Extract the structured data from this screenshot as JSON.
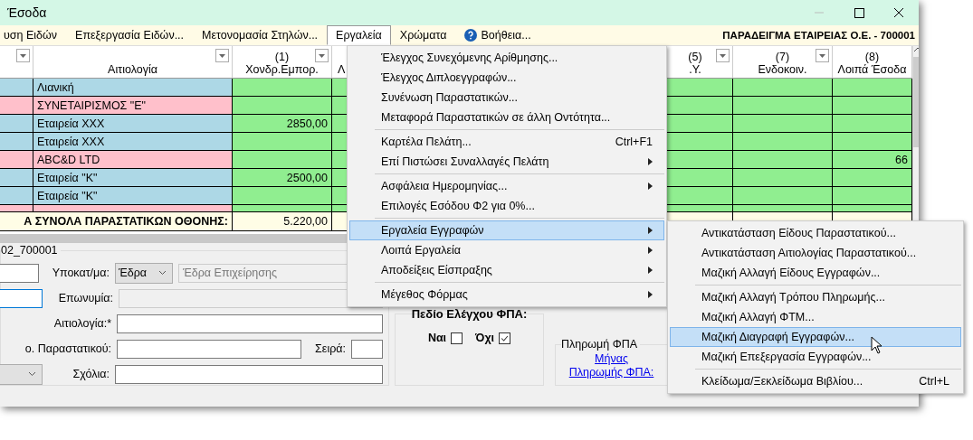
{
  "window": {
    "title": "Έσοδα"
  },
  "menu_bar": {
    "items": [
      {
        "label": "υση Ειδών",
        "selected": false,
        "kind": "text"
      },
      {
        "label": "Επεξεργασία Ειδών...",
        "selected": false,
        "kind": "text"
      },
      {
        "label": "Μετονομασία Στηλών...",
        "selected": false,
        "kind": "text"
      },
      {
        "label": "Εργαλεία",
        "selected": true,
        "kind": "text"
      },
      {
        "label": "Χρώματα",
        "selected": false,
        "kind": "text"
      },
      {
        "label": "Βοήθεια...",
        "selected": false,
        "kind": "help"
      }
    ],
    "company": "ΠΑΡΑΔΕΙΓΜΑ ΕΤΑΙΡΕΙΑΣ Ο.Ε. - 700001"
  },
  "table": {
    "columns": [
      {
        "label": "Αιτιολογία"
      },
      {
        "number": "(1)",
        "label": "Χονδρ.Εμπορ."
      },
      {
        "label": "Λ"
      },
      {
        "number": "(5)",
        "label": ".Υ."
      },
      {
        "number": "(7)",
        "label": "Ενδοκοιν."
      },
      {
        "number": "(8)",
        "label": "Λοιπά Έσοδα"
      }
    ],
    "rows": [
      {
        "label": "Λιανική",
        "color": "#add8e6"
      },
      {
        "label": "ΣΥΝΕΤΑΙΡΙΣΜΟΣ \"Ε\"",
        "color": "#ffc0cb"
      },
      {
        "label": "Εταιρεία XXX",
        "color": "#add8e6",
        "values": {
          "column_1": "2850,00"
        }
      },
      {
        "label": "Εταιρεία XXX",
        "color": "#add8e6"
      },
      {
        "label": "ABC&D LTD",
        "color": "#ffc0cb",
        "values": {
          "column_5": "66"
        }
      },
      {
        "label": "Εταιρεία \"Κ\"",
        "color": "#add8e6",
        "values": {
          "column_1": "2500,00"
        }
      },
      {
        "label": "Εταιρεία \"Κ\"",
        "color": "#add8e6"
      },
      {
        "color": "#ffc0cb"
      }
    ],
    "totals": {
      "label": "Α ΣΥΝΟΛΑ ΠΑΡΑΣΤΑΤΙΚΩΝ ΟΘΟΝΗΣ:",
      "values": {
        "column_1": "5.220,00"
      }
    }
  },
  "menu": {
    "items": [
      {
        "kind": "item",
        "label": "Έλεγχος Συνεχόμενης Αρίθμησης...",
        "selected": false,
        "submenu": false
      },
      {
        "kind": "item",
        "label": "Έλεγχος Διπλοεγγραφών...",
        "selected": false,
        "submenu": false
      },
      {
        "kind": "item",
        "label": "Συνένωση Παραστατικών...",
        "selected": false,
        "submenu": false
      },
      {
        "kind": "item",
        "label": "Μεταφορά Παραστατικών σε άλλη Οντότητα...",
        "selected": false,
        "submenu": false
      },
      {
        "kind": "separator"
      },
      {
        "kind": "item",
        "label": "Καρτέλα Πελάτη...",
        "shortcut": "Ctrl+F1",
        "selected": false,
        "submenu": false
      },
      {
        "kind": "item",
        "label": "Επί Πιστώσει Συναλλαγές Πελάτη",
        "selected": false,
        "submenu": true
      },
      {
        "kind": "separator"
      },
      {
        "kind": "item",
        "label": "Ασφάλεια Ημερομηνίας...",
        "selected": false,
        "submenu": true
      },
      {
        "kind": "item",
        "label": "Επιλογές Εσόδου Φ2 για 0%...",
        "selected": false,
        "submenu": false
      },
      {
        "kind": "separator"
      },
      {
        "kind": "item",
        "label": "Εργαλεία Εγγραφών",
        "selected": true,
        "submenu": true
      },
      {
        "kind": "item",
        "label": "Λοιπά Εργαλεία",
        "selected": false,
        "submenu": true
      },
      {
        "kind": "item",
        "label": "Αποδείξεις Είσπραξης",
        "selected": false,
        "submenu": true
      },
      {
        "kind": "separator"
      },
      {
        "kind": "item",
        "label": "Μέγεθος Φόρμας",
        "selected": false,
        "submenu": true
      }
    ]
  },
  "submenu": {
    "items": [
      {
        "kind": "item",
        "label": "Αντικατάσταση Είδους Παραστατικού...",
        "selected": false,
        "submenu": false
      },
      {
        "kind": "item",
        "label": "Αντικατάσταση Αιτιολογίας Παραστατικού...",
        "selected": false,
        "submenu": false
      },
      {
        "kind": "item",
        "label": "Μαζική Αλλαγή Είδους Εγγραφών...",
        "selected": false,
        "submenu": false
      },
      {
        "kind": "separator"
      },
      {
        "kind": "item",
        "label": "Μαζική Αλλαγή Τρόπου Πληρωμής...",
        "selected": false,
        "submenu": false
      },
      {
        "kind": "item",
        "label": "Μαζική Αλλαγή ΦΤΜ...",
        "selected": false,
        "submenu": false
      },
      {
        "kind": "item",
        "label": "Μαζική Διαγραφή Εγγραφών...",
        "selected": true,
        "submenu": false
      },
      {
        "kind": "item",
        "label": "Μαζική Επεξεργασία Εγγραφών...",
        "selected": false,
        "submenu": false
      },
      {
        "kind": "separator"
      },
      {
        "kind": "item",
        "label": "Κλείδωμα/Ξεκλείδωμα Βιβλίου...",
        "shortcut": "Ctrl+L",
        "selected": false,
        "submenu": false
      }
    ]
  },
  "form": {
    "group_title": "02_700001",
    "branch_label": "Υποκατ/μα:",
    "branch_select": "Έδρα",
    "branch_name": "Έδρα Επιχείρησης",
    "name_label": "Επωνυμία:",
    "reason_label": "Αιτιολογία:*",
    "doc_label": "ο. Παραστατικού:",
    "series_label": "Σειρά:",
    "comments_label": "Σχόλια:",
    "vat_check": {
      "title": "Πεδίο Ελέγχου ΦΠΑ:",
      "options": [
        {
          "label": "Ναι",
          "checked": false
        },
        {
          "label": "Όχι",
          "checked": true
        }
      ]
    },
    "vat_payment": {
      "title": "Πληρωμή ΦΠΑ",
      "link": "Μήνας Πληρωμής ΦΠΑ:"
    }
  }
}
